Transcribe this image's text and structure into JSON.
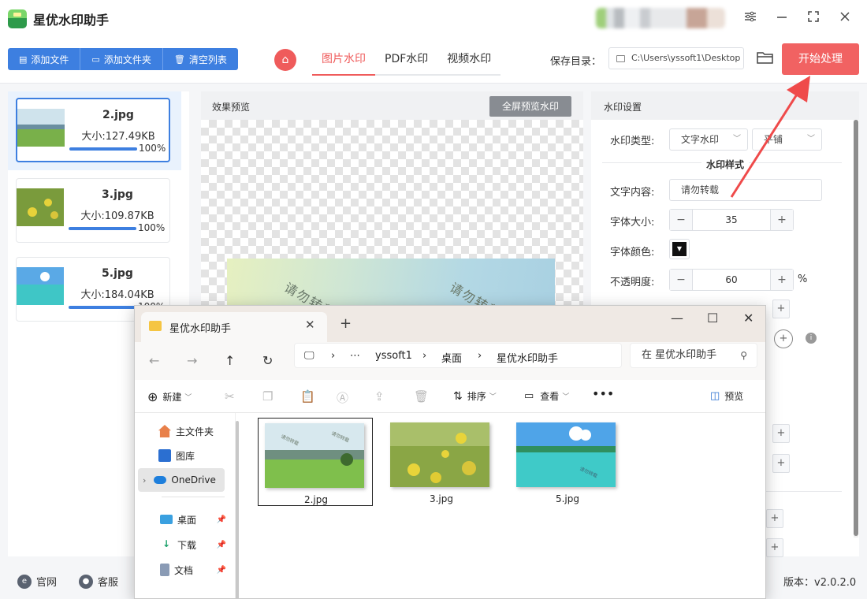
{
  "app": {
    "title": "星优水印助手",
    "window_controls": [
      "settings-icon",
      "minimize-icon",
      "maximize-icon",
      "close-icon"
    ]
  },
  "toolbar": {
    "add_file": "添加文件",
    "add_folder": "添加文件夹",
    "clear_list": "清空列表",
    "tabs": [
      "图片水印",
      "PDF水印",
      "视频水印"
    ],
    "active_tab": "图片水印",
    "save_label": "保存目录：",
    "save_path": "C:\\Users\\yssoft1\\Desktop",
    "start_button": "开始处理",
    "accent": "#3d7fe0",
    "start_color": "#f16262"
  },
  "files": [
    {
      "name": "2.jpg",
      "size": "大小:127.49KB",
      "progress": "100%",
      "progress_value": 1.0
    },
    {
      "name": "3.jpg",
      "size": "大小:109.87KB",
      "progress": "100%",
      "progress_value": 1.0
    },
    {
      "name": "5.jpg",
      "size": "大小:184.04KB",
      "progress": "100%",
      "progress_value": 1.0
    }
  ],
  "preview": {
    "title": "效果预览",
    "fullscreen_button": "全屏预览水印",
    "watermark_text": "请勿转载"
  },
  "settings": {
    "title": "水印设置",
    "type_label": "水印类型:",
    "type_value": "文字水印",
    "layout_value": "平铺",
    "section_title": "水印样式",
    "text_label": "文字内容:",
    "text_value": "请勿转载",
    "font_size_label": "字体大小:",
    "font_size_value": "35",
    "font_color_label": "字体颜色:",
    "font_color": "#111111",
    "opacity_label": "不透明度:",
    "opacity_value": "60",
    "opacity_unit": "%"
  },
  "bottom": {
    "website": "官网",
    "support": "客服",
    "version": "版本：v2.0.2.0"
  },
  "explorer": {
    "tab_title": "星优水印助手",
    "breadcrumb": [
      "yssoft1",
      "桌面",
      "星优水印助手"
    ],
    "search_placeholder": "在 星优水印助手",
    "commands": {
      "new": "新建",
      "sort": "排序",
      "view": "查看",
      "preview": "预览"
    },
    "sidebar": [
      {
        "label": "主文件夹",
        "icon": "home-icon"
      },
      {
        "label": "图库",
        "icon": "gallery-icon"
      },
      {
        "label": "OneDrive",
        "icon": "cloud-icon"
      },
      {
        "label": "桌面",
        "icon": "desktop-icon"
      },
      {
        "label": "下载",
        "icon": "download-icon"
      },
      {
        "label": "文档",
        "icon": "document-icon"
      }
    ],
    "files": [
      "2.jpg",
      "3.jpg",
      "5.jpg"
    ]
  }
}
